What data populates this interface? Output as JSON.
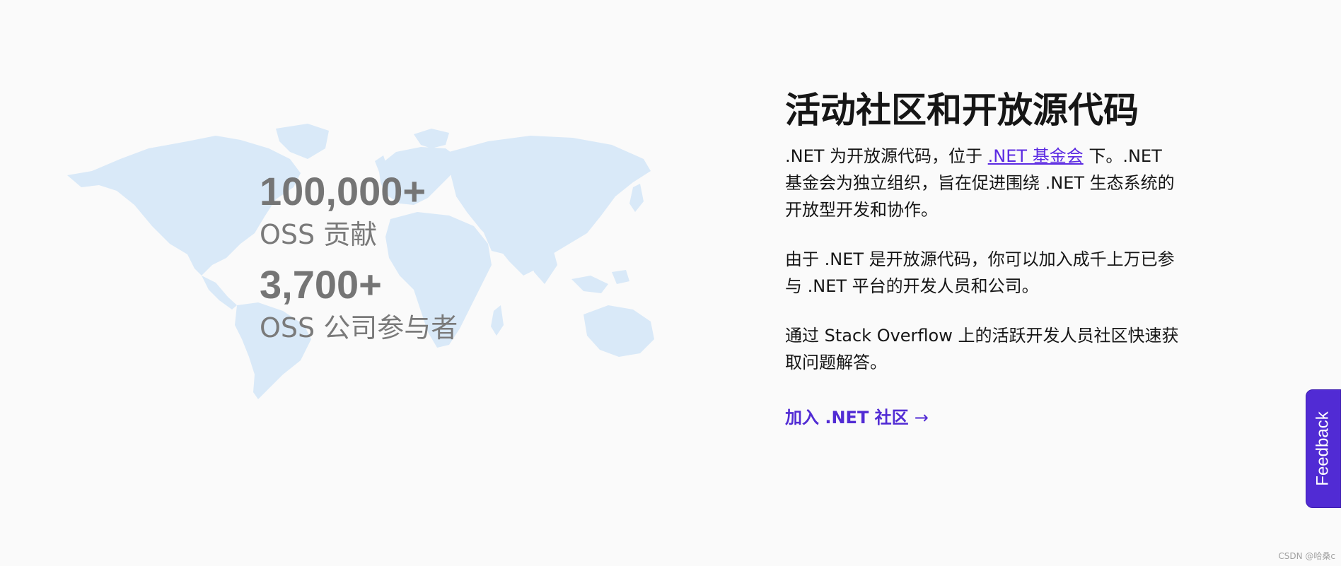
{
  "stats": [
    {
      "number": "100,000+",
      "label": "OSS 贡献"
    },
    {
      "number": "3,700+",
      "label": "OSS 公司参与者"
    }
  ],
  "content": {
    "heading": "活动社区和开放源代码",
    "para1_before": ".NET 为开放源代码，位于 ",
    "para1_link": ".NET 基金会",
    "para1_after": " 下。.NET 基金会为独立组织，旨在促进围绕 .NET 生态系统的开放型开发和协作。",
    "para2": "由于 .NET 是开放源代码，你可以加入成千上万已参与 .NET 平台的开发人员和公司。",
    "para3": "通过 Stack Overflow 上的活跃开发人员社区快速获取问题解答。",
    "cta_label": "加入 .NET 社区",
    "cta_arrow": "→"
  },
  "feedback": {
    "label": "Feedback"
  },
  "watermark": "CSDN @哈桑c",
  "colors": {
    "accent": "#512bd4",
    "link": "#5c2be2",
    "map": "#d9e9f8",
    "background": "#fafafa"
  },
  "icons": {
    "world_map": "world-map-icon",
    "cta_arrow": "arrow-right-icon"
  }
}
